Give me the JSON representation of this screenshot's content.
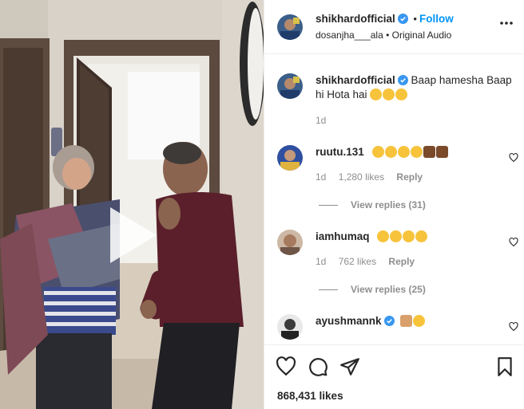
{
  "header": {
    "username": "shikhardofficial",
    "follow_separator": "•",
    "follow_label": "Follow",
    "audio_user": "dosanjha___ala",
    "audio_separator": "•",
    "audio_label": "Original Audio"
  },
  "caption": {
    "username": "shikhardofficial",
    "text": "Baap hamesha Baap hi Hota hai",
    "time": "1d"
  },
  "comments": [
    {
      "username": "ruutu.131",
      "time": "1d",
      "likes": "1,280 likes",
      "reply_label": "Reply",
      "view_replies": "View replies (31)"
    },
    {
      "username": "iamhumaq",
      "time": "1d",
      "likes": "762 likes",
      "reply_label": "Reply",
      "view_replies": "View replies (25)"
    },
    {
      "username": "ayushmannk"
    }
  ],
  "footer": {
    "likes": "868,431 likes"
  },
  "colors": {
    "accent": "#0095f6",
    "verified": "#3897f0",
    "text": "#262626",
    "muted": "#8e8e8e"
  },
  "icons": [
    "verified-badge-icon",
    "more-options-icon",
    "heart-icon",
    "comment-icon",
    "share-icon",
    "bookmark-icon",
    "play-icon"
  ]
}
